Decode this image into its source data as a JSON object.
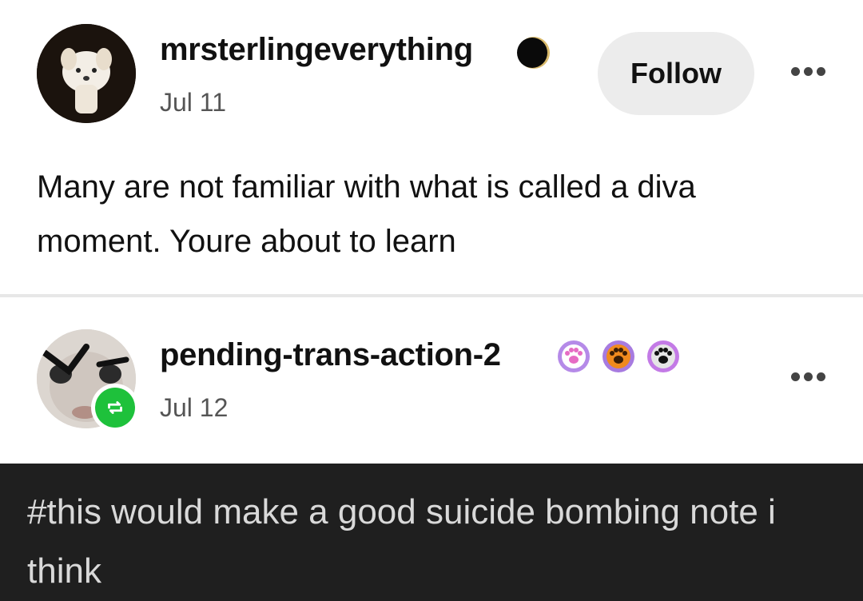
{
  "post": {
    "author": "mrsterlingeverything",
    "date": "Jul 11",
    "follow_label": "Follow",
    "body": "Many are not familiar with what is called a diva moment. Youre about to learn",
    "badge_icon": "eclipse-moon-icon",
    "avatar_icon": "puppy-avatar"
  },
  "reblog": {
    "author": "pending-trans-action-2",
    "date": "Jul 12",
    "avatar_icon": "reblogger-avatar",
    "reblog_icon": "reblog-icon",
    "badges": [
      "paw-pink",
      "paw-orange",
      "paw-black"
    ],
    "tags": "#this would make a good suicide bombing note i think"
  },
  "colors": {
    "reblog_green": "#1ec13b",
    "tags_background": "#1f1f1f",
    "follow_background": "#ececec"
  }
}
